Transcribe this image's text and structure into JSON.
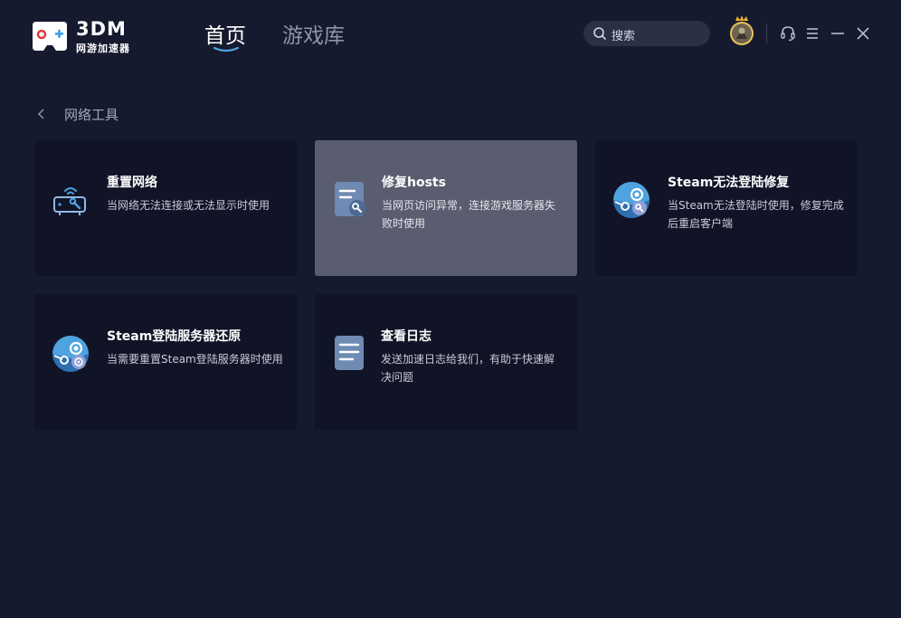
{
  "app": {
    "logo_name": "3DM",
    "logo_sub": "网游加速器"
  },
  "nav": {
    "tabs": [
      {
        "label": "首页",
        "active": true
      },
      {
        "label": "游戏库",
        "active": false
      }
    ]
  },
  "search": {
    "placeholder": "搜索",
    "icon": "search-icon"
  },
  "window_controls": [
    "headset-icon",
    "menu-icon",
    "minimize-icon",
    "close-icon"
  ],
  "breadcrumb": {
    "label": "网络工具"
  },
  "tools": [
    {
      "title": "重置网络",
      "desc": "当网络无法连接或无法显示时使用",
      "icon": "router-wrench-icon"
    },
    {
      "title": "修复hosts",
      "desc": "当网页访问异常，连接游戏服务器失败时使用",
      "icon": "document-wrench-icon"
    },
    {
      "title": "Steam无法登陆修复",
      "desc": "当Steam无法登陆时使用，修复完成后重启客户端",
      "icon": "steam-wrench-icon"
    },
    {
      "title": "Steam登陆服务器还原",
      "desc": "当需要重置Steam登陆服务器时使用",
      "icon": "steam-restore-icon"
    },
    {
      "title": "查看日志",
      "desc": "发送加速日志给我们，有助于快速解决问题",
      "icon": "log-document-icon"
    }
  ],
  "colors": {
    "background": "#161a2e",
    "card": "#111427",
    "card_hover": "#5a5d6f",
    "accent_blue": "#4fa3e0",
    "logo_red": "#e4393c"
  }
}
